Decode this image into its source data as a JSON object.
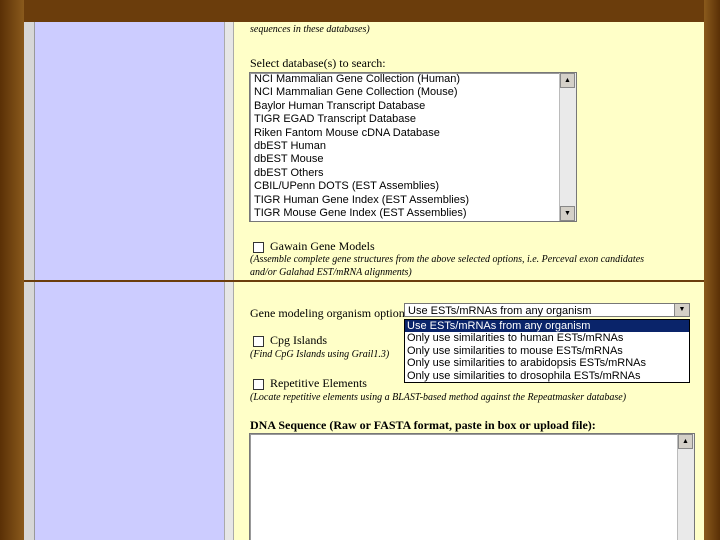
{
  "top": {
    "intro_tail": "sequences in these databases)",
    "select_db_label": "Select database(s) to search:",
    "databases": [
      "NCI Mammalian Gene Collection (Human)",
      "NCI Mammalian Gene Collection (Mouse)",
      "Baylor Human Transcript Database",
      "TIGR EGAD Transcript Database",
      "Riken Fantom Mouse cDNA Database",
      "dbEST Human",
      "dbEST Mouse",
      "dbEST Others",
      "CBIL/UPenn DOTS (EST Assemblies)",
      "TIGR Human Gene Index (EST Assemblies)",
      "TIGR Mouse Gene Index (EST Assemblies)"
    ],
    "gawain_label": "Gawain Gene Models",
    "gawain_desc_1": "(Assemble complete gene structures from the above selected options, i.e. Perceval exon candidates",
    "gawain_desc_2": "and/or Galahad EST/mRNA alignments)"
  },
  "bottom": {
    "organism_label": "Gene modeling organism options:",
    "organism_selected": "Use ESTs/mRNAs from any organism",
    "organism_options": [
      "Use ESTs/mRNAs from any organism",
      "Only use similarities to human ESTs/mRNAs",
      "Only use similarities to mouse ESTs/mRNAs",
      "Only use similarities to arabidopsis ESTs/mRNAs",
      "Only use similarities to drosophila ESTs/mRNAs"
    ],
    "cpg_label": "Cpg Islands",
    "cpg_desc": "(Find CpG Islands using Grail1.3)",
    "repeat_label": "Repetitive Elements",
    "repeat_desc": "(Locate repetitive elements using a BLAST-based method against the Repeatmasker database)",
    "dna_label": "DNA Sequence (Raw or FASTA format, paste in box or upload file):",
    "dna_value": ""
  }
}
